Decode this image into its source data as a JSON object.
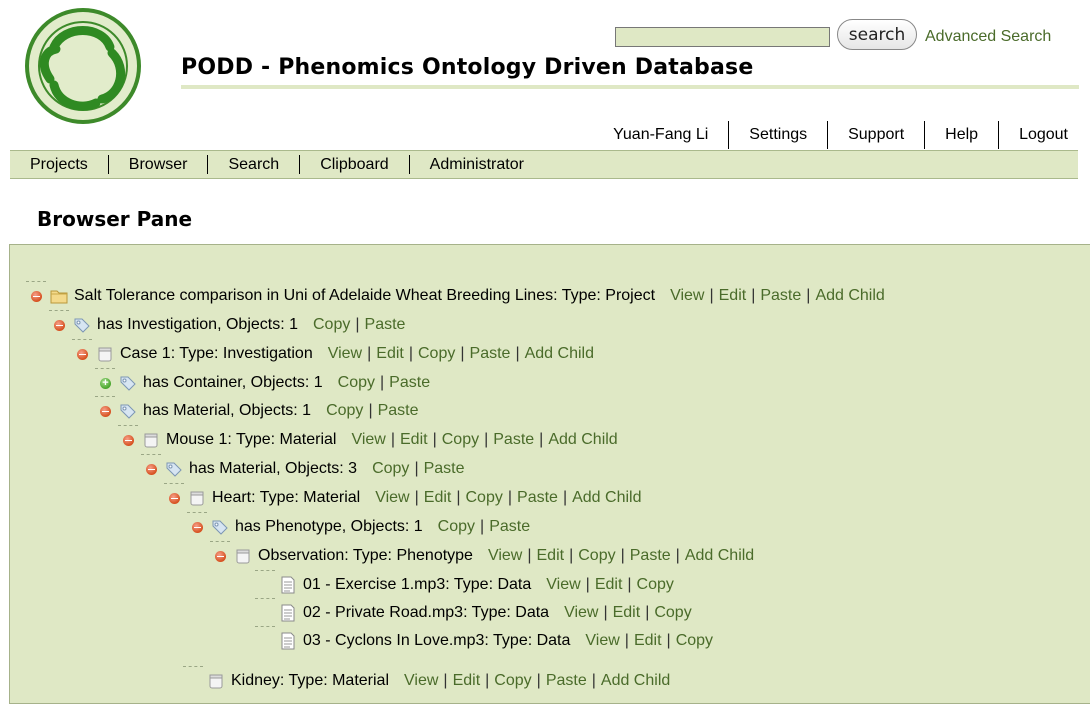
{
  "header": {
    "title": "PODD - Phenomics Ontology Driven Database",
    "search_button_label": "search",
    "search_value": "",
    "advanced_search_label": "Advanced Search"
  },
  "user_nav": [
    "Yuan-Fang Li",
    "Settings",
    "Support",
    "Help",
    "Logout"
  ],
  "main_nav": [
    "Projects",
    "Browser",
    "Search",
    "Clipboard",
    "Administrator"
  ],
  "pane": {
    "title": "Browser Pane",
    "rows": [
      {
        "label": "Salt Tolerance comparison in Uni of Adelaide Wheat Breeding Lines: Type: Project",
        "icon": "folder-icon",
        "toggle": "minus",
        "actions": [
          "View",
          "Edit",
          "Paste",
          "Add Child"
        ]
      },
      {
        "label": "has Investigation, Objects: 1",
        "icon": "tag-icon",
        "toggle": "minus",
        "actions": [
          "Copy",
          "Paste"
        ]
      },
      {
        "label": "Case 1: Type: Investigation",
        "icon": "container-icon",
        "toggle": "minus",
        "actions": [
          "View",
          "Edit",
          "Copy",
          "Paste",
          "Add Child"
        ]
      },
      {
        "label": "has Container, Objects: 1",
        "icon": "tag-icon",
        "toggle": "plus",
        "actions": [
          "Copy",
          "Paste"
        ]
      },
      {
        "label": "has Material, Objects: 1",
        "icon": "tag-icon",
        "toggle": "minus",
        "actions": [
          "Copy",
          "Paste"
        ]
      },
      {
        "label": "Mouse 1: Type: Material",
        "icon": "container-icon",
        "toggle": "minus",
        "actions": [
          "View",
          "Edit",
          "Copy",
          "Paste",
          "Add Child"
        ]
      },
      {
        "label": "has Material, Objects: 3",
        "icon": "tag-icon",
        "toggle": "minus",
        "actions": [
          "Copy",
          "Paste"
        ]
      },
      {
        "label": "Heart: Type: Material",
        "icon": "container-icon",
        "toggle": "minus",
        "actions": [
          "View",
          "Edit",
          "Copy",
          "Paste",
          "Add Child"
        ]
      },
      {
        "label": "has Phenotype, Objects: 1",
        "icon": "tag-icon",
        "toggle": "minus",
        "actions": [
          "Copy",
          "Paste"
        ]
      },
      {
        "label": "Observation: Type: Phenotype",
        "icon": "container-icon",
        "toggle": "minus",
        "actions": [
          "View",
          "Edit",
          "Copy",
          "Paste",
          "Add Child"
        ]
      },
      {
        "label": "01 - Exercise 1.mp3: Type: Data",
        "icon": "document-icon",
        "toggle": "none",
        "actions": [
          "View",
          "Edit",
          "Copy"
        ]
      },
      {
        "label": "02 - Private Road.mp3: Type: Data",
        "icon": "document-icon",
        "toggle": "none",
        "actions": [
          "View",
          "Edit",
          "Copy"
        ]
      },
      {
        "label": "03 - Cyclons In Love.mp3: Type: Data",
        "icon": "document-icon",
        "toggle": "none",
        "actions": [
          "View",
          "Edit",
          "Copy"
        ]
      },
      {
        "label": "Kidney: Type: Material",
        "icon": "container-icon",
        "toggle": "none",
        "actions": [
          "View",
          "Edit",
          "Copy",
          "Paste",
          "Add Child"
        ]
      }
    ]
  },
  "colors": {
    "pane_background": "#dfe8c5",
    "nav_background": "#dfe8c5",
    "link": "#4a6b2a",
    "collapse_toggle": "#d6501f",
    "expand_toggle": "#47a52b"
  }
}
